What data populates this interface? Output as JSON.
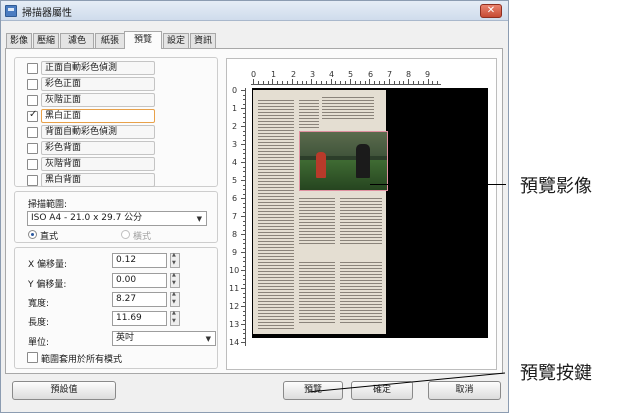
{
  "window": {
    "title": "掃描器屬性",
    "close_label": "✕"
  },
  "tabs": [
    {
      "label": "影像"
    },
    {
      "label": "壓縮"
    },
    {
      "label": "濾色"
    },
    {
      "label": "紙張"
    },
    {
      "label": "預覽",
      "active": true
    },
    {
      "label": "設定"
    },
    {
      "label": "資訊"
    }
  ],
  "image_options": [
    {
      "label": "正面自動彩色偵測",
      "checked": false
    },
    {
      "label": "彩色正面",
      "checked": false
    },
    {
      "label": "灰階正面",
      "checked": false
    },
    {
      "label": "黑白正面",
      "checked": true
    },
    {
      "label": "背面自動彩色偵測",
      "checked": false
    },
    {
      "label": "彩色背面",
      "checked": false
    },
    {
      "label": "灰階背面",
      "checked": false
    },
    {
      "label": "黑白背面",
      "checked": false
    }
  ],
  "scan_area": {
    "label": "掃描範圍:",
    "selected": "ISO A4 - 21.0 x 29.7 公分",
    "portrait_label": "直式",
    "landscape_label": "橫式"
  },
  "offsets": {
    "x_label": "X 偏移量:",
    "x_value": "0.12",
    "y_label": "Y 偏移量:",
    "y_value": "0.00",
    "width_label": "寬度:",
    "width_value": "8.27",
    "length_label": "長度:",
    "length_value": "11.69",
    "unit_label": "單位:",
    "unit_value": "英吋",
    "apply_all_label": "範圍套用於所有模式"
  },
  "ruler": {
    "top": [
      "0",
      "1",
      "2",
      "3",
      "4",
      "5",
      "6",
      "7",
      "8",
      "9"
    ],
    "left": [
      "0",
      "1",
      "2",
      "3",
      "4",
      "5",
      "6",
      "7",
      "8",
      "9",
      "10",
      "11",
      "12",
      "13",
      "14"
    ]
  },
  "buttons": {
    "default_label": "預設值",
    "preview_label": "預覽",
    "ok_label": "確定",
    "cancel_label": "取消"
  },
  "annotations": {
    "preview_image": "預覽影像",
    "preview_button": "預覽按鍵"
  },
  "colors": {
    "selected_border": "#e8a14a",
    "close_button": "#c64a34"
  }
}
